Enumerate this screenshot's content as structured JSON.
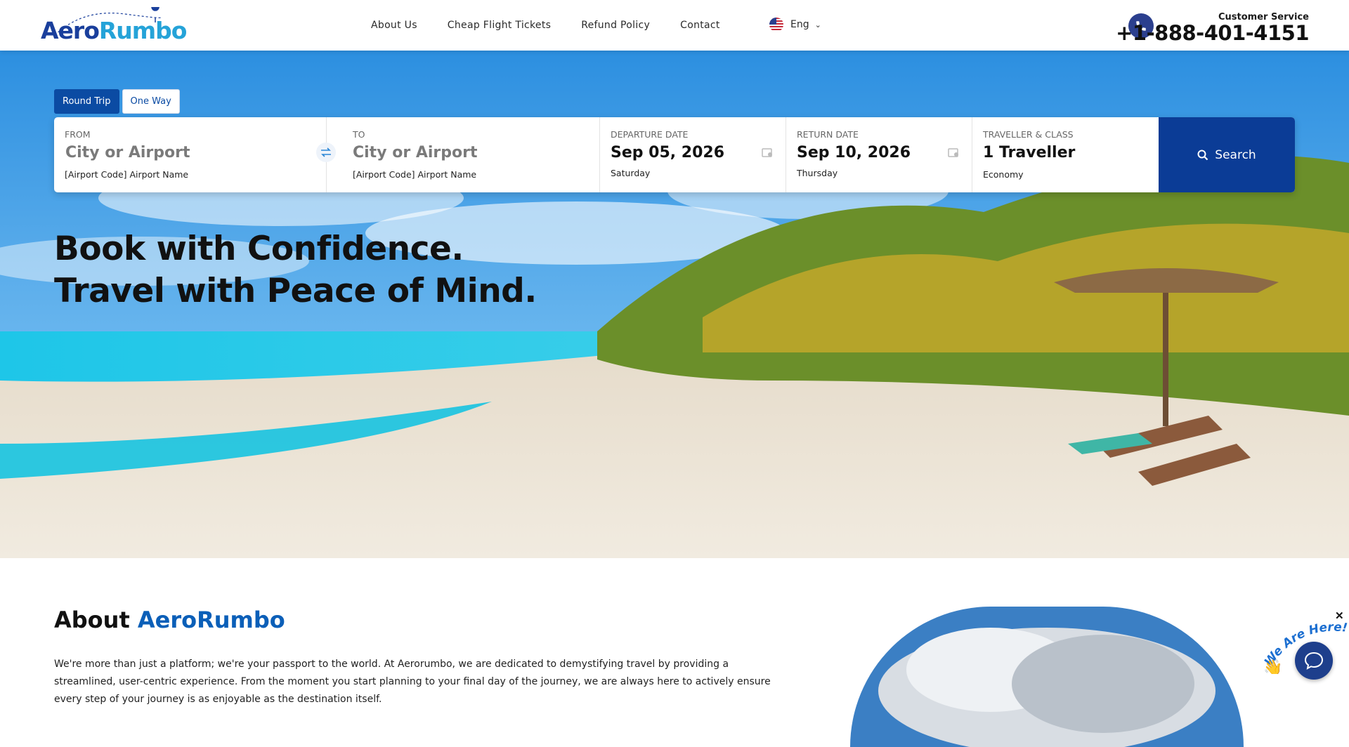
{
  "header": {
    "logo": {
      "part1": "Aero",
      "part2": "Rumbo"
    },
    "nav": [
      {
        "label": "About Us"
      },
      {
        "label": "Cheap Flight Tickets"
      },
      {
        "label": "Refund Policy"
      },
      {
        "label": "Contact"
      }
    ],
    "language": {
      "label": "Eng",
      "flag_icon": "us-flag-icon"
    },
    "customer_service": {
      "label": "Customer Service",
      "phone": "+1-888-401-4151"
    }
  },
  "search": {
    "trip_types": [
      {
        "label": "Round Trip",
        "active": true
      },
      {
        "label": "One Way",
        "active": false
      }
    ],
    "from": {
      "label": "FROM",
      "placeholder": "City or Airport",
      "sub": "[Airport Code] Airport Name"
    },
    "to": {
      "label": "TO",
      "placeholder": "City or Airport",
      "sub": "[Airport Code] Airport Name"
    },
    "departure": {
      "label": "DEPARTURE DATE",
      "value": "Sep 05, 2026",
      "day": "Saturday"
    },
    "return": {
      "label": "RETURN DATE",
      "value": "Sep 10, 2026",
      "day": "Thursday"
    },
    "traveller": {
      "label": "TRAVELLER & CLASS",
      "value": "1 Traveller",
      "class": "Economy"
    },
    "button_label": "Search"
  },
  "hero": {
    "title_line1": "Book with Confidence.",
    "title_line2": "Travel with Peace of Mind."
  },
  "about": {
    "title_prefix": "About",
    "title_brand": "AeroRumbo",
    "paragraph": "We're more than just a platform; we're your passport to the world. At Aerorumbo, we are dedicated to demystifying travel by providing a streamlined, user-centric experience. From the moment you start planning to your final day of the journey, we are always here to actively ensure every step of your journey is as enjoyable as the destination itself."
  },
  "chat": {
    "badge_text": "We Are Here!"
  },
  "colors": {
    "primary": "#0b3c96",
    "brand_blue": "#0b5fb8",
    "active_tab": "#0b4ba3",
    "phone_icon_bg": "#2b3f8e"
  }
}
